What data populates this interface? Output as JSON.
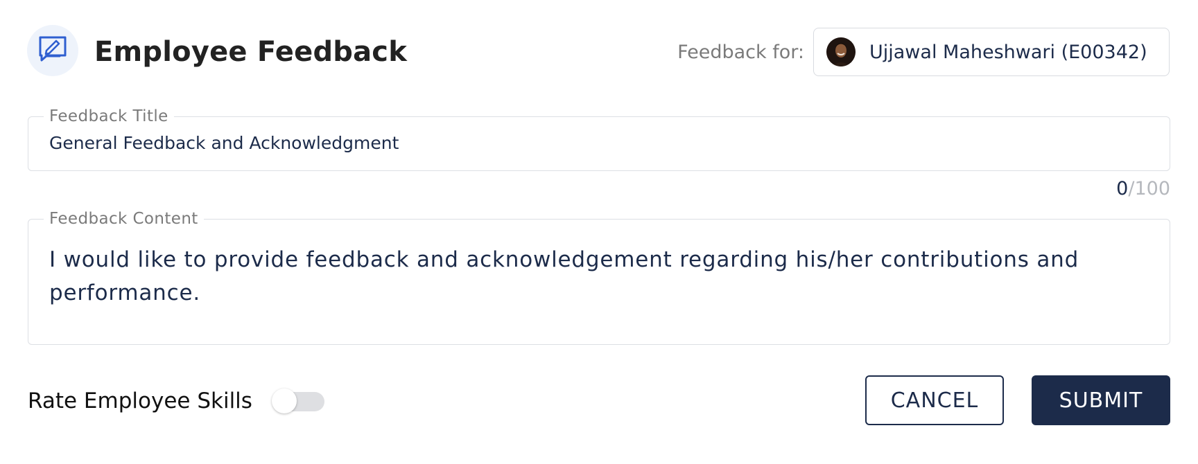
{
  "header": {
    "title": "Employee Feedback",
    "icon": "feedback-edit-icon",
    "feedback_for_label": "Feedback for:",
    "employee": {
      "name": "Ujjawal Maheshwari (E00342)",
      "avatar": "employee-avatar"
    }
  },
  "form": {
    "title_field": {
      "label": "Feedback Title",
      "value": "General Feedback and Acknowledgment",
      "char_count": "0",
      "char_max": "/100"
    },
    "content_field": {
      "label": "Feedback Content",
      "value": "I would like to provide feedback and acknowledgement regarding his/her contributions and performance."
    },
    "rate_skills": {
      "label": "Rate Employee Skills",
      "enabled": false
    }
  },
  "actions": {
    "cancel_label": "CANCEL",
    "submit_label": "SUBMIT"
  },
  "colors": {
    "primary": "#1c2b4a",
    "icon_accent": "#2f5fd0",
    "muted_text": "#7a7a7a",
    "border": "#dcdfe4"
  }
}
